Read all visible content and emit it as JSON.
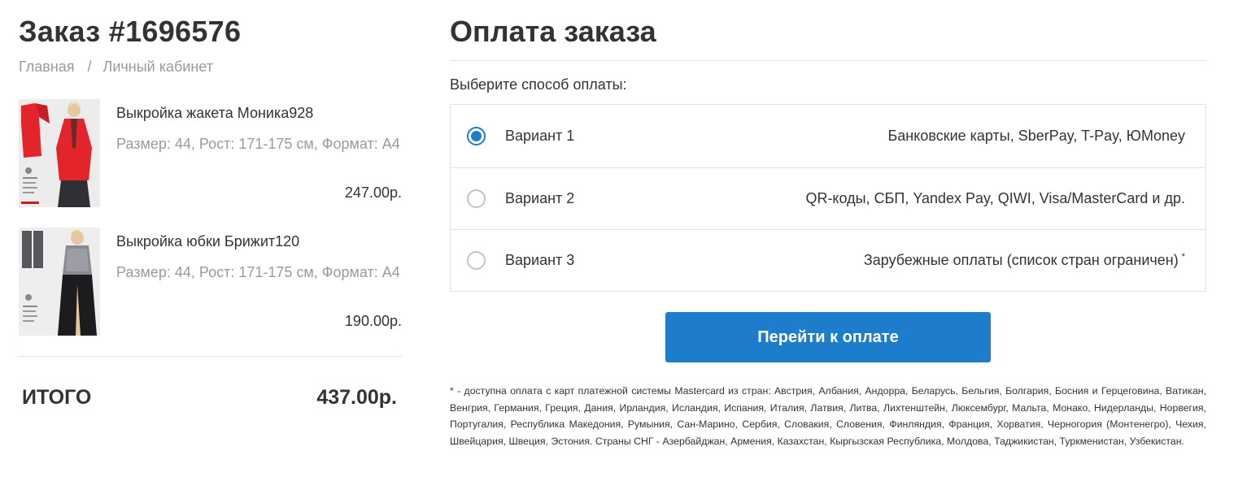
{
  "order": {
    "title": "Заказ #1696576",
    "breadcrumb": {
      "home": "Главная",
      "separator": "/",
      "account": "Личный кабинет"
    },
    "items": [
      {
        "name": "Выкройка жакета Моника928",
        "details": "Размер: 44, Рост: 171-175 см, Формат: А4",
        "price": "247.00р.",
        "image": "jacket-pattern-thumbnail"
      },
      {
        "name": "Выкройка юбки Брижит120",
        "details": "Размер: 44, Рост: 171-175 см, Формат: А4",
        "price": "190.00р.",
        "image": "skirt-pattern-thumbnail"
      }
    ],
    "total_label": "ИТОГО",
    "total_value": "437.00р."
  },
  "payment": {
    "title": "Оплата заказа",
    "prompt": "Выберите способ оплаты:",
    "options": [
      {
        "label": "Вариант 1",
        "description": "Банковские карты, SberPay, T-Pay, ЮMoney",
        "selected": true,
        "star": ""
      },
      {
        "label": "Вариант 2",
        "description": "QR-коды, СБП, Yandex Pay, QIWI, Visa/MasterCard и др.",
        "selected": false,
        "star": ""
      },
      {
        "label": "Вариант 3",
        "description": "Зарубежные оплаты (список стран ограничен)",
        "selected": false,
        "star": "*"
      }
    ],
    "button_label": "Перейти к оплате",
    "footnote": "* - доступна оплата с карт платежной системы Mastercard из стран: Австрия, Албания, Андорра, Беларусь, Бельгия, Болгария, Босния и Герцеговина, Ватикан, Венгрия, Германия, Греция, Дания, Ирландия, Исландия, Испания, Италия, Латвия, Литва, Лихтенштейн, Люксембург, Мальта, Монако, Нидерланды, Норвегия, Португалия, Республика Македония, Румыния, Сан-Марино, Сербия, Словакия, Словения, Финляндия, Франция, Хорватия, Черногория (Монтенегро), Чехия, Швейцария, Швеция, Эстония. Страны СНГ - Азербайджан, Армения, Казахстан, Кыргызская Республика, Молдова, Таджикистан, Туркменистан, Узбекистан."
  },
  "colors": {
    "accent": "#1e7ccc",
    "text": "#333333",
    "muted": "#9a9a9a",
    "border": "#e2e2e2",
    "jacket": "#e3242b",
    "skirt": "#222222"
  }
}
